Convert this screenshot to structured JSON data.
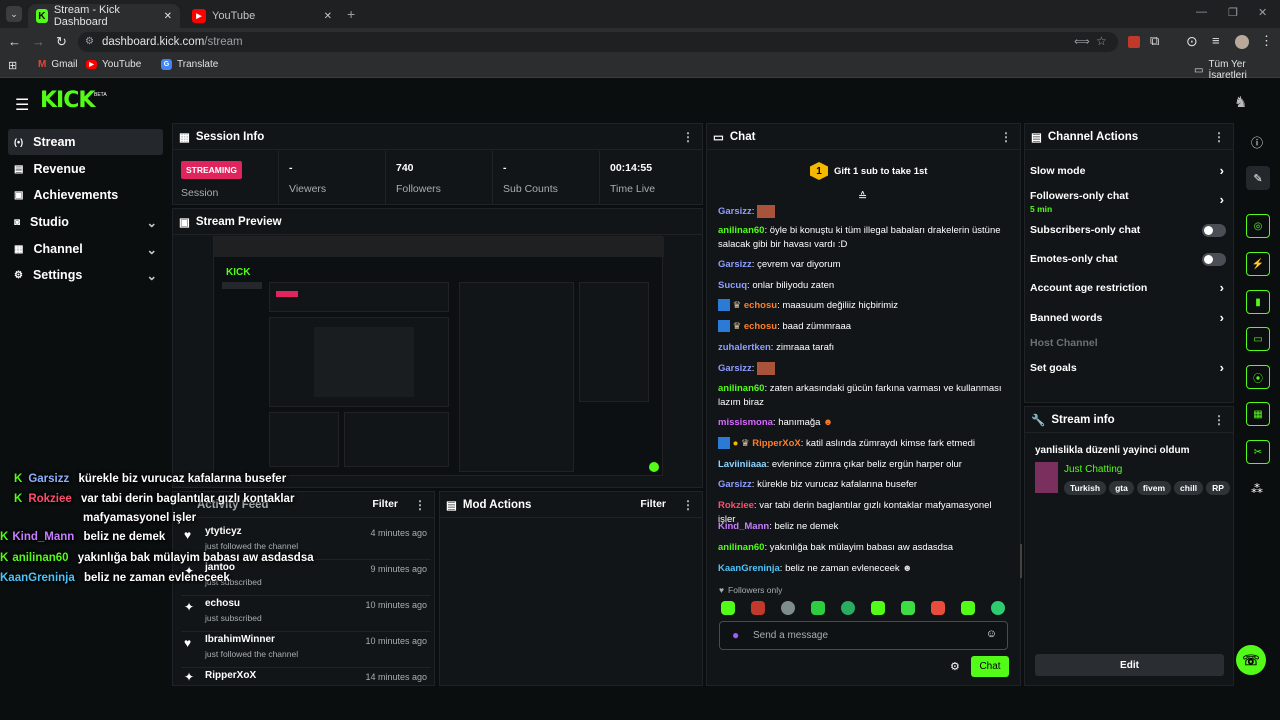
{
  "browser": {
    "tabs": [
      {
        "title": "Stream - Kick Dashboard"
      },
      {
        "title": "YouTube"
      }
    ],
    "url_host": "dashboard.kick.com",
    "url_path": "/stream",
    "bookmarks": [
      "Gmail",
      "YouTube",
      "Translate"
    ],
    "bookmarks_right": "Tüm Yer İşaretleri"
  },
  "app": {
    "logo": "KICK",
    "beta": "BETA"
  },
  "sidebar": {
    "items": [
      {
        "label": "Stream",
        "icon": "broadcast-icon"
      },
      {
        "label": "Revenue",
        "icon": "wallet-icon"
      },
      {
        "label": "Achievements",
        "icon": "medal-icon"
      },
      {
        "label": "Studio",
        "icon": "studio-icon"
      },
      {
        "label": "Channel",
        "icon": "channel-icon"
      },
      {
        "label": "Settings",
        "icon": "gear-icon"
      }
    ]
  },
  "session": {
    "title": "Session Info",
    "badge": "STREAMING",
    "session_label": "Session",
    "stats": [
      {
        "value": "-",
        "label": "Viewers"
      },
      {
        "value": "740",
        "label": "Followers"
      },
      {
        "value": "-",
        "label": "Sub Counts"
      },
      {
        "value": "00:14:55",
        "label": "Time Live"
      }
    ]
  },
  "preview": {
    "title": "Stream Preview"
  },
  "activity": {
    "title": "Activity Feed",
    "filter": "Filter",
    "items": [
      {
        "name": "ytyticyz",
        "desc": "just followed the channel",
        "time": "4 minutes ago",
        "icon": "heart-icon"
      },
      {
        "name": "jantoo",
        "desc": "just subscribed",
        "time": "9 minutes ago",
        "icon": "star-icon"
      },
      {
        "name": "echosu",
        "desc": "just subscribed",
        "time": "10 minutes ago",
        "icon": "star-icon"
      },
      {
        "name": "IbrahimWinner",
        "desc": "just followed the channel",
        "time": "10 minutes ago",
        "icon": "heart-icon"
      },
      {
        "name": "RipperXoX",
        "desc": "",
        "time": "14 minutes ago",
        "icon": "star-icon"
      }
    ]
  },
  "mod": {
    "title": "Mod Actions",
    "filter": "Filter"
  },
  "chat": {
    "title": "Chat",
    "gift": "Gift 1 sub to take 1st",
    "lines": [
      {
        "user": "Garsizz",
        "color": "#8f9eff",
        "text": ""
      },
      {
        "user": "anilinan60",
        "color": "#53fc18",
        "text": "öyle bi konuştu ki tüm illegal babaları drakelerin üstüne salacak gibi bir havası vardı :D"
      },
      {
        "user": "Garsizz",
        "color": "#8f9eff",
        "text": "çevrem var diyorum"
      },
      {
        "user": "Sucuq",
        "color": "#8f9eff",
        "text": "onlar biliyodu zaten"
      },
      {
        "user": "echosu",
        "color": "#ff7f27",
        "text": "maasuum değiliiz hiçbirimiz"
      },
      {
        "user": "echosu",
        "color": "#ff7f27",
        "text": "baad zümmraaa"
      },
      {
        "user": "zuhalertken",
        "color": "#8f9eff",
        "text": "zimraaa tarafı"
      },
      {
        "user": "Garsizz",
        "color": "#8f9eff",
        "text": ""
      },
      {
        "user": "anilinan60",
        "color": "#53fc18",
        "text": "zaten arkasındaki gücün farkına varması ve kullanması lazım biraz"
      },
      {
        "user": "missismona",
        "color": "#d966ff",
        "text": "hanımağa"
      },
      {
        "user": "RipperXoX",
        "color": "#ff7f27",
        "text": "katil aslında zümraydı kimse fark etmedi"
      },
      {
        "user": "Laviiniiaaa",
        "color": "#8fd3ff",
        "text": "evlenince zümra çıkar beliz ergün harper olur"
      },
      {
        "user": "Garsizz",
        "color": "#8f9eff",
        "text": "kürekle biz vurucaz kafalarına busefer"
      },
      {
        "user": "Rokziee",
        "color": "#ff4d6d",
        "text": "var tabi derin baglantılar gızlı kontaklar mafyamasyonel işler"
      },
      {
        "user": "Kind_Mann",
        "color": "#c77dff",
        "text": "beliz ne demek"
      },
      {
        "user": "anilinan60",
        "color": "#53fc18",
        "text": "yakınlığa bak mülayim babası aw asdasdsa"
      },
      {
        "user": "KaanGreninja",
        "color": "#4fc3f7",
        "text": "beliz ne zaman evleneceek"
      }
    ],
    "followers_only": "Followers only",
    "placeholder": "Send a message",
    "send": "Chat"
  },
  "overlay": {
    "lines": [
      {
        "user": "Garsizz",
        "color": "#8fb0ff",
        "text": "kürekle biz vurucaz kafalarına busefer"
      },
      {
        "user": "Rokziee",
        "color": "#ff4d6d",
        "text": "var tabi derin baglantılar gızlı kontaklar"
      },
      {
        "user": "",
        "color": "#fff",
        "text": "mafyamasyonel işler"
      },
      {
        "user": "Kind_Mann",
        "color": "#c77dff",
        "text": "beliz ne demek"
      },
      {
        "user": "anilinan60",
        "color": "#53fc18",
        "text": "yakınlığa bak mülayim babası aw asdasdsa"
      },
      {
        "user": "KaanGreninja",
        "color": "#4fc3f7",
        "text": "beliz ne zaman evleneceek"
      }
    ]
  },
  "channel_actions": {
    "title": "Channel Actions",
    "items": [
      {
        "label": "Slow mode",
        "control": "chevron"
      },
      {
        "label": "Followers-only chat",
        "sub": "5 min",
        "control": "chevron"
      },
      {
        "label": "Subscribers-only chat",
        "control": "toggle"
      },
      {
        "label": "Emotes-only chat",
        "control": "toggle"
      },
      {
        "label": "Account age restriction",
        "control": "chevron"
      },
      {
        "label": "Banned words",
        "control": "chevron"
      },
      {
        "label": "Host Channel",
        "control": "none"
      },
      {
        "label": "Set goals",
        "control": "chevron"
      }
    ]
  },
  "stream_info": {
    "title": "Stream info",
    "stream_title": "yanlislikla düzenli yayinci oldum",
    "category": "Just Chatting",
    "tags": [
      "Turkish",
      "gta",
      "fivem",
      "chill",
      "RP"
    ],
    "edit": "Edit"
  },
  "colors": {
    "accent": "#53fc18",
    "badge": "#e0245e"
  }
}
